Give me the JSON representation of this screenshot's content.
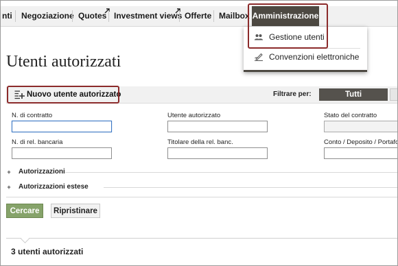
{
  "nav": {
    "items": [
      {
        "label": "nti"
      },
      {
        "label": "Negoziazione"
      },
      {
        "label": "Quotes"
      },
      {
        "label": "Investment views"
      },
      {
        "label": "Offerte"
      },
      {
        "label": "Mailbox"
      },
      {
        "label": "Amministrazione"
      }
    ]
  },
  "dropdown": {
    "items": [
      {
        "label": "Gestione utenti",
        "icon": "users-icon"
      },
      {
        "label": "Convenzioni elettroniche",
        "icon": "signature-icon"
      }
    ]
  },
  "page": {
    "title": "Utenti autorizzati"
  },
  "toolbar": {
    "new_user_label": "Nuovo utente autorizzato",
    "filter_label": "Filtrare per:",
    "filter_active": "Tutti"
  },
  "form": {
    "fields": [
      {
        "label": "N. di contratto",
        "value": ""
      },
      {
        "label": "Utente autorizzato",
        "value": ""
      },
      {
        "label": "Stato del contratto",
        "value": ""
      },
      {
        "label": "N. di rel. bancaria",
        "value": ""
      },
      {
        "label": "Titolare della rel. banc.",
        "value": ""
      },
      {
        "label": "Conto / Deposito / Portafoglio",
        "value": ""
      }
    ],
    "sections": [
      {
        "label": "Autorizzazioni",
        "sign": "+"
      },
      {
        "label": "Autorizzazioni estese",
        "sign": "+"
      }
    ],
    "search_label": "Cercare",
    "reset_label": "Ripristinare"
  },
  "results": {
    "count_label": "3 utenti autorizzati"
  },
  "colors": {
    "nav_active": "#4d4942",
    "highlight": "#8b2a2a",
    "search_button": "#86a36a",
    "filter_active": "#55524d"
  }
}
